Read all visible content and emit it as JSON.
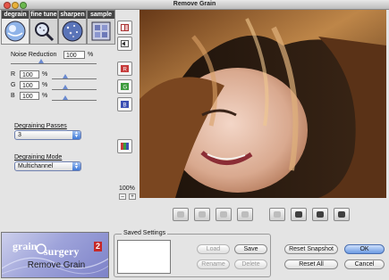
{
  "window": {
    "title": "Remove Grain"
  },
  "tabs": [
    {
      "label": "degrain",
      "icon": "degrain-sphere-icon",
      "active": true
    },
    {
      "label": "fine tune",
      "icon": "magnifier-icon",
      "active": false
    },
    {
      "label": "sharpen",
      "icon": "sharpen-sphere-icon",
      "active": false
    },
    {
      "label": "sample",
      "icon": "sample-grid-icon",
      "active": false
    }
  ],
  "noise_reduction": {
    "label": "Noise Reduction",
    "value": "100",
    "unit": "%",
    "level": 1.0,
    "channels": [
      {
        "label": "R",
        "value": "100",
        "unit": "%",
        "level": 0.2
      },
      {
        "label": "G",
        "value": "100",
        "unit": "%",
        "level": 0.2
      },
      {
        "label": "B",
        "value": "100",
        "unit": "%",
        "level": 0.2
      }
    ]
  },
  "degraining_passes": {
    "label": "Degraining Passes",
    "value": "3"
  },
  "degraining_mode": {
    "label": "Degraining Mode",
    "value": "Multichannel"
  },
  "zoom": {
    "value": "100%",
    "minus": "–",
    "plus": "+"
  },
  "logo": {
    "line1": "grain",
    "line2": "surgery",
    "badge": "2",
    "subtitle": "Remove Grain"
  },
  "saved_settings": {
    "title": "Saved Settings",
    "load": "Load",
    "save": "Save",
    "rename": "Rename",
    "delete": "Delete"
  },
  "actions": {
    "reset_snapshot": "Reset Snapshot",
    "reset_all": "Reset All",
    "ok": "OK",
    "cancel": "Cancel"
  },
  "colors": {
    "accent": "#3f78d6",
    "tab_header": "#444444",
    "logo_bg": "#9ea3da"
  }
}
